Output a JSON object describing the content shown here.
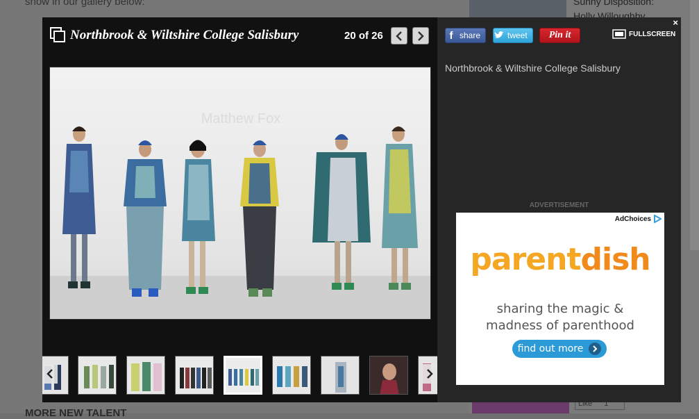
{
  "background_page": {
    "top_text": "show in our gallery below:",
    "bottom_heading": "MORE NEW TALENT",
    "sidebar_story_line1": "Sunny Disposition:",
    "sidebar_story_line2": "Holly Willoughby",
    "like_label": "Like",
    "like_count": "1"
  },
  "gallery": {
    "title": "Northbrook & Wiltshire College Salisbury",
    "counter": "20 of 26",
    "caption": "Northbrook & Wiltshire College Salisbury",
    "watermark": "Matthew Fox",
    "thumbnails_count": 9,
    "active_thumbnail_index": 4
  },
  "share": {
    "facebook_label": "share",
    "twitter_label": "tweet",
    "pinterest_label": "Pin it",
    "fullscreen_label": "FULLSCREEN",
    "close_glyph": "×"
  },
  "ad": {
    "label": "ADVERTISEMENT",
    "adchoices": "AdChoices",
    "brand_part1": "parent",
    "brand_part2": "dish",
    "tagline_line1": "sharing the magic &",
    "tagline_line2": "madness of parenthood",
    "cta": "find out more"
  },
  "colors": {
    "facebook": "#3b5998",
    "twitter": "#2ea3d9",
    "pinterest": "#b0151c",
    "brand_orange": "#f5a623",
    "cta_blue": "#2c9ad6"
  }
}
